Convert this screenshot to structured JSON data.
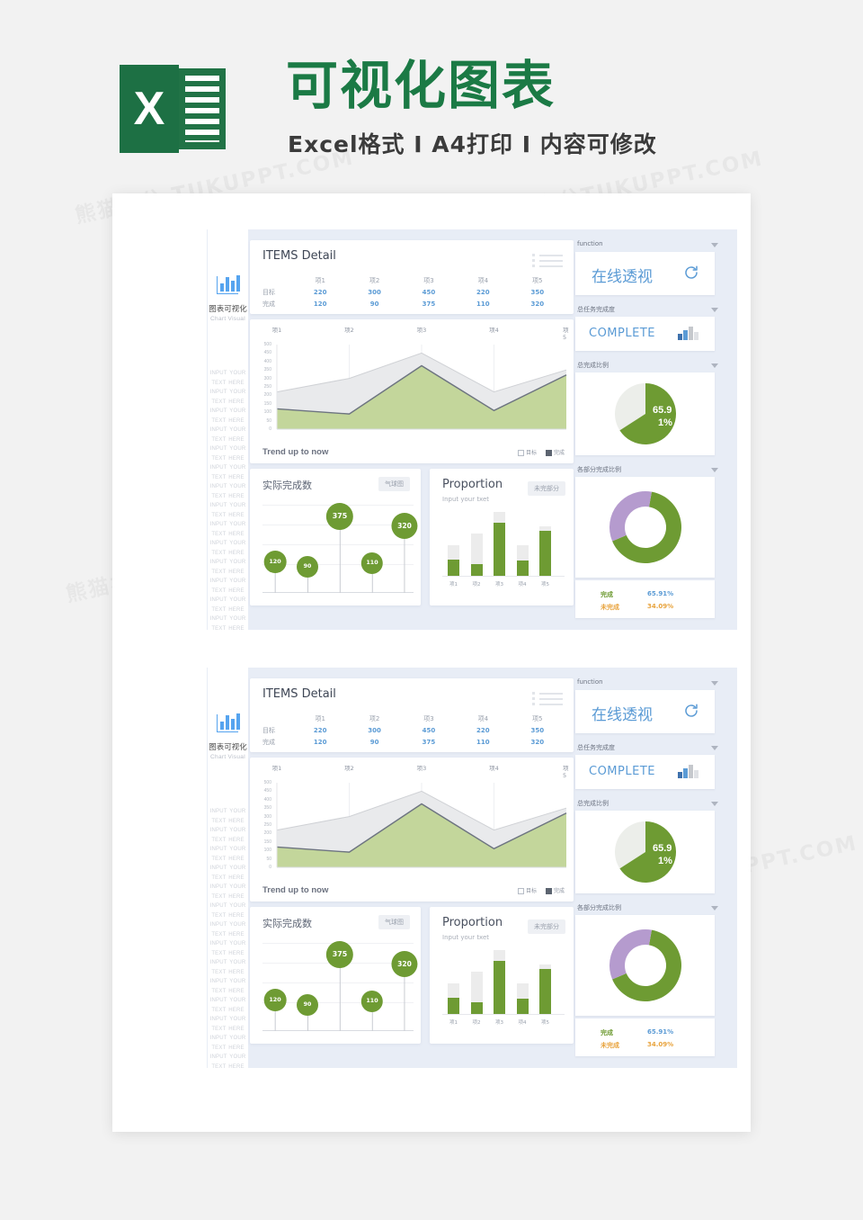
{
  "header": {
    "logo_letter": "X",
    "title": "可视化图表",
    "subtitle": "Excel格式 Ι A4打印 Ι 内容可修改",
    "brand_green": "#1b7a45"
  },
  "watermarks": [
    "熊猫办公 TUKUPPT.COM",
    "熊猫办公TUKUPPT.COM",
    "熊猫办公 TUKUPPT.COM",
    "熊猫办公TUKUPPT.COM",
    "熊猫办公TUKUPPT.COM",
    "熊猫办公 TUKUPPT.COM"
  ],
  "sidebar": {
    "brand_cn": "图表可视化",
    "brand_en": "Chart Visual",
    "icon": "bar-chart-icon",
    "filler_text": "INPUT YOUR TEXT HERE INPUT YOUR TEXT HERE INPUT YOUR TEXT HERE INPUT YOUR TEXT HERE INPUT YOUR TEXT HERE INPUT YOUR TEXT HERE INPUT YOUR TEXT HERE INPUT YOUR TEXT HERE INPUT YOUR TEXT HERE INPUT YOUR TEXT HERE INPUT YOUR TEXT HERE INPUT YOUR TEXT HERE INPUT YOUR TEXT HERE INPUT YOUR TEXT HERE"
  },
  "items_card": {
    "title": "ITEMS Detail",
    "icon": "list-icon",
    "columns": [
      "项1",
      "项2",
      "项3",
      "项4",
      "项5"
    ],
    "rows": [
      {
        "label": "目标",
        "values": [
          "220",
          "300",
          "450",
          "220",
          "350"
        ]
      },
      {
        "label": "完成",
        "values": [
          "120",
          "90",
          "375",
          "110",
          "320"
        ]
      }
    ],
    "value_color": "#5b9bd5"
  },
  "trend_card": {
    "footer": "Trend up to now",
    "legend": [
      {
        "name": "目标",
        "filled": false
      },
      {
        "name": "完成",
        "filled": true
      }
    ]
  },
  "balloon_card": {
    "title": "实际完成数",
    "tag": "气球图"
  },
  "proportion_card": {
    "title": "Proportion",
    "subtitle": "Input your txet",
    "tag": "未完部分"
  },
  "widgets": {
    "function": {
      "label": "function",
      "value": "在线透视",
      "icon": "refresh-icon",
      "caret": "chevron-down-icon"
    },
    "complete": {
      "label": "总任务完成度",
      "value": "COMPLETE",
      "icon": "bar-chart-icon",
      "caret": "chevron-down-icon"
    },
    "pie": {
      "label": "总完成比例",
      "value_line1": "65.9",
      "value_line2": "1%",
      "caret": "chevron-down-icon"
    },
    "donut": {
      "label": "各部分完成比例",
      "caret": "chevron-down-icon",
      "legend": [
        {
          "name": "完成",
          "value": "65.91%",
          "name_color": "#6e9b33",
          "value_color": "#5b9bd5"
        },
        {
          "name": "未完成",
          "value": "34.09%",
          "name_color": "#e8a33d",
          "value_color": "#e8a33d"
        }
      ]
    }
  },
  "chart_data": [
    {
      "type": "area",
      "title": "Trend up to now",
      "categories": [
        "项1",
        "项2",
        "项3",
        "项4",
        "项5"
      ],
      "series": [
        {
          "name": "目标",
          "values": [
            220,
            300,
            450,
            220,
            350
          ],
          "color": "#e9eaec"
        },
        {
          "name": "完成",
          "values": [
            120,
            90,
            375,
            110,
            320
          ],
          "color": "#c3d69b"
        }
      ],
      "ylim": [
        0,
        500
      ],
      "yticks": [
        0,
        50,
        100,
        150,
        200,
        250,
        300,
        350,
        400,
        450,
        500
      ],
      "xlabel": "",
      "ylabel": "",
      "grid": true,
      "legend_position": "bottom-right"
    },
    {
      "type": "scatter",
      "title": "实际完成数",
      "categories": [
        "项1",
        "项2",
        "项3",
        "项4",
        "项5"
      ],
      "values": [
        120,
        90,
        375,
        110,
        320
      ],
      "ylim": [
        0,
        450
      ],
      "color": "#6e9b33",
      "grid": true
    },
    {
      "type": "bar",
      "title": "Proportion",
      "categories": [
        "项1",
        "项2",
        "项3",
        "项4",
        "项5"
      ],
      "series": [
        {
          "name": "完成",
          "values": [
            120,
            90,
            375,
            110,
            320
          ],
          "color": "#6e9b33"
        },
        {
          "name": "未完部分",
          "values": [
            100,
            210,
            75,
            110,
            30
          ],
          "color": "#ececec"
        }
      ],
      "stacked": true,
      "ylim": [
        0,
        450
      ],
      "grid": false
    },
    {
      "type": "pie",
      "title": "总完成比例",
      "labels": [
        "完成",
        "未完成"
      ],
      "values": [
        65.91,
        34.09
      ],
      "colors": [
        "#6e9b33",
        "#eceeea"
      ],
      "data_label": "65.91%"
    },
    {
      "type": "pie",
      "title": "各部分完成比例",
      "labels": [
        "完成",
        "未完成"
      ],
      "values": [
        65.91,
        34.09
      ],
      "colors": [
        "#6e9b33",
        "#b59bce"
      ],
      "donut": true
    }
  ]
}
